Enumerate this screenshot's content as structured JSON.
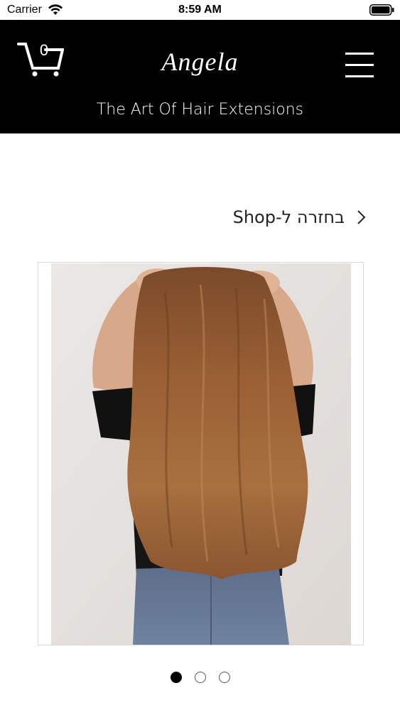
{
  "status_bar": {
    "carrier": "Carrier",
    "time": "8:59 AM"
  },
  "header": {
    "brand": "Angela",
    "tagline": "The Art Of Hair Extensions",
    "cart_count": "0",
    "icons": [
      "cart-icon",
      "menu-icon"
    ]
  },
  "navigation": {
    "back_link_label": "בחזרה ל-Shop"
  },
  "product": {
    "image_icon": "product-photo-long-wavy-brown-hair"
  },
  "carousel": {
    "dots": 3,
    "active_index": 0
  },
  "colors": {
    "header_bg": "#000000",
    "header_text": "#ffffff",
    "page_bg": "#ffffff"
  }
}
